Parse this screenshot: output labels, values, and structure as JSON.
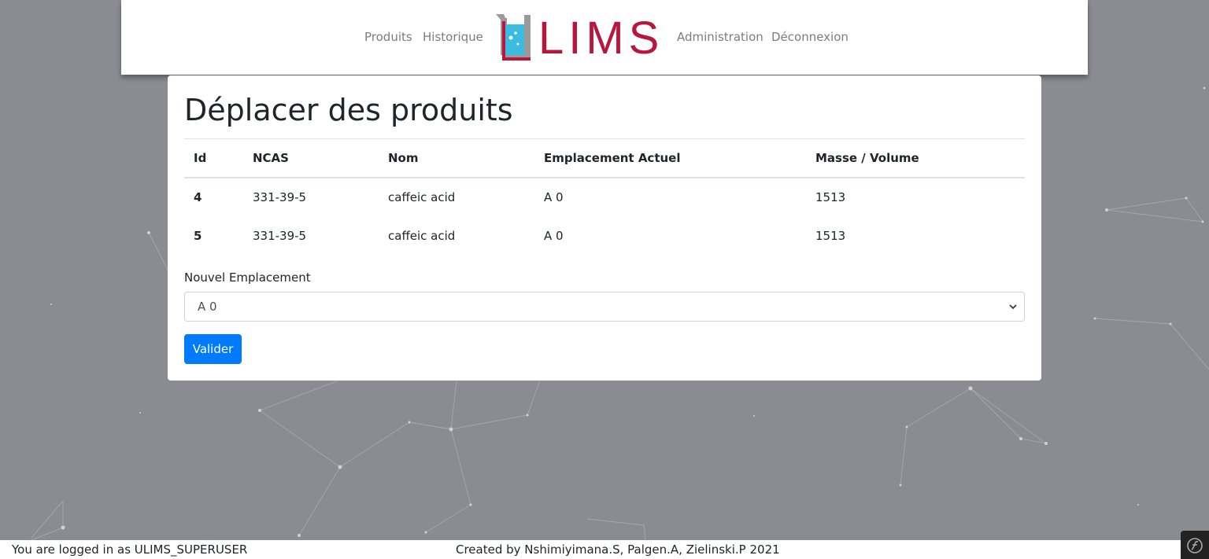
{
  "nav": {
    "products": "Produits",
    "history": "Historique",
    "administration": "Administration",
    "logout": "Déconnexion",
    "logo_text": "LIMS",
    "logo_color": "#b8163d",
    "logo_icon": "beaker-icon"
  },
  "page": {
    "title": "Déplacer des produits"
  },
  "table": {
    "headers": [
      "Id",
      "NCAS",
      "Nom",
      "Emplacement Actuel",
      "Masse / Volume"
    ],
    "rows": [
      [
        "4",
        "331-39-5",
        "caffeic acid",
        "A 0",
        "1513"
      ],
      [
        "5",
        "331-39-5",
        "caffeic acid",
        "A 0",
        "1513"
      ]
    ]
  },
  "form": {
    "location_label": "Nouvel Emplacement",
    "location_selected": "A 0",
    "submit_label": "Valider",
    "submit_color": "#007bff"
  },
  "footer": {
    "logged_in": "You are logged in as ULIMS_SUPERUSER",
    "credits": "Created by Nshimiyimana.S, Palgen.A, Zielinski.P 2021"
  },
  "theme": {
    "background": "#8b8c91"
  }
}
